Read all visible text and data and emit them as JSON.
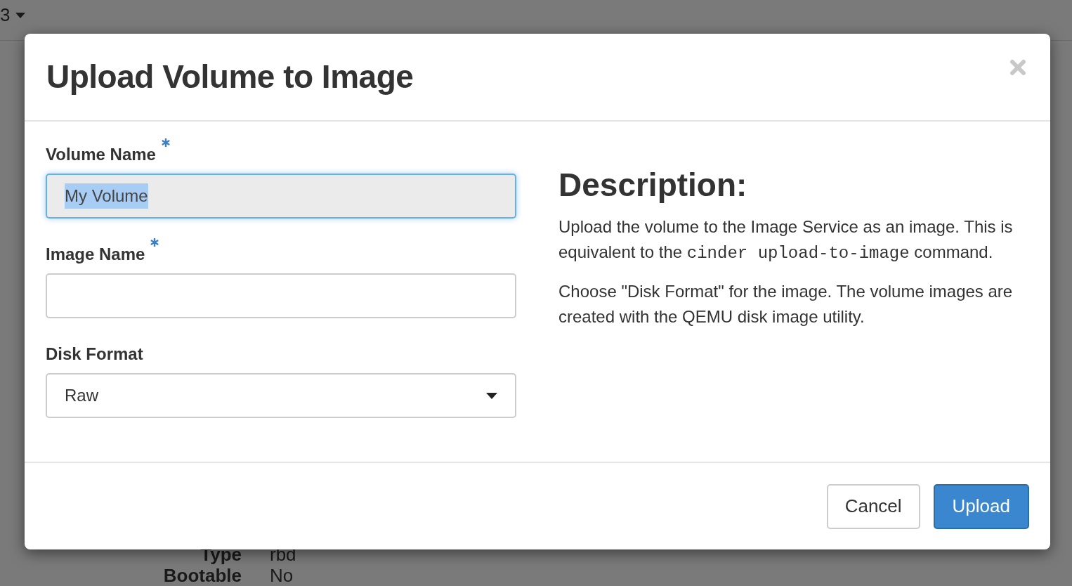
{
  "background": {
    "top_selector": "3",
    "details": [
      {
        "label": "Type",
        "value": "rbd"
      },
      {
        "label": "Bootable",
        "value": "No"
      }
    ]
  },
  "modal": {
    "title": "Upload Volume to Image",
    "fields": [
      {
        "kind": "text",
        "label": "Volume Name",
        "required": true,
        "value": "My Volume",
        "readonly": true,
        "focused": true,
        "text_selected": true
      },
      {
        "kind": "text",
        "label": "Image Name",
        "required": true,
        "readonly": false,
        "focused": false
      },
      {
        "kind": "select",
        "label": "Disk Format",
        "value": "Raw"
      }
    ],
    "description": {
      "heading": "Description:",
      "paragraphs": [
        [
          {
            "kind": "text",
            "text": "Upload the volume to the Image Service as an image. This is equivalent to the "
          },
          {
            "kind": "code",
            "text": "cinder upload-to-image"
          },
          {
            "kind": "text",
            "text": " command."
          }
        ],
        [
          {
            "kind": "text",
            "text": "Choose \"Disk Format\" for the image. The volume images are created with the QEMU disk image utility."
          }
        ]
      ]
    },
    "buttons": [
      {
        "kind": "default",
        "label": "Cancel"
      },
      {
        "kind": "primary",
        "label": "Upload"
      }
    ]
  }
}
